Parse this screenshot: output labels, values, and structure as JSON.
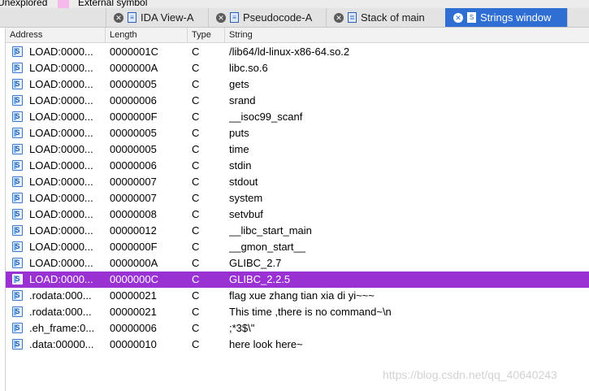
{
  "legend": {
    "unexplored_label": "Unexplored",
    "external_symbol_label": "External symbol",
    "external_symbol_color": "#f7b8ec"
  },
  "tabs": [
    {
      "label": "IDA View-A",
      "icon": "disassembly-icon",
      "active": false
    },
    {
      "label": "Pseudocode-A",
      "icon": "pseudocode-icon",
      "active": false
    },
    {
      "label": "Stack of main",
      "icon": "stack-icon",
      "active": false
    },
    {
      "label": "Strings window",
      "icon": "strings-icon",
      "active": true
    }
  ],
  "table": {
    "columns": [
      "Address",
      "Length",
      "Type",
      "String"
    ],
    "selected_row_color": "#9a31d2",
    "rows": [
      {
        "address": "LOAD:0000...",
        "length": "0000001C",
        "type": "C",
        "string": "/lib64/ld-linux-x86-64.so.2",
        "selected": false
      },
      {
        "address": "LOAD:0000...",
        "length": "0000000A",
        "type": "C",
        "string": "libc.so.6",
        "selected": false
      },
      {
        "address": "LOAD:0000...",
        "length": "00000005",
        "type": "C",
        "string": "gets",
        "selected": false
      },
      {
        "address": "LOAD:0000...",
        "length": "00000006",
        "type": "C",
        "string": "srand",
        "selected": false
      },
      {
        "address": "LOAD:0000...",
        "length": "0000000F",
        "type": "C",
        "string": "__isoc99_scanf",
        "selected": false
      },
      {
        "address": "LOAD:0000...",
        "length": "00000005",
        "type": "C",
        "string": "puts",
        "selected": false
      },
      {
        "address": "LOAD:0000...",
        "length": "00000005",
        "type": "C",
        "string": "time",
        "selected": false
      },
      {
        "address": "LOAD:0000...",
        "length": "00000006",
        "type": "C",
        "string": "stdin",
        "selected": false
      },
      {
        "address": "LOAD:0000...",
        "length": "00000007",
        "type": "C",
        "string": "stdout",
        "selected": false
      },
      {
        "address": "LOAD:0000...",
        "length": "00000007",
        "type": "C",
        "string": "system",
        "selected": false
      },
      {
        "address": "LOAD:0000...",
        "length": "00000008",
        "type": "C",
        "string": "setvbuf",
        "selected": false
      },
      {
        "address": "LOAD:0000...",
        "length": "00000012",
        "type": "C",
        "string": "__libc_start_main",
        "selected": false
      },
      {
        "address": "LOAD:0000...",
        "length": "0000000F",
        "type": "C",
        "string": "__gmon_start__",
        "selected": false
      },
      {
        "address": "LOAD:0000...",
        "length": "0000000A",
        "type": "C",
        "string": "GLIBC_2.7",
        "selected": false
      },
      {
        "address": "LOAD:0000...",
        "length": "0000000C",
        "type": "C",
        "string": "GLIBC_2.2.5",
        "selected": true
      },
      {
        "address": ".rodata:000...",
        "length": "00000021",
        "type": "C",
        "string": "flag xue zhang tian xia di yi~~~",
        "selected": false
      },
      {
        "address": ".rodata:000...",
        "length": "00000021",
        "type": "C",
        "string": "This time ,there is no command~\\n",
        "selected": false
      },
      {
        "address": ".eh_frame:0...",
        "length": "00000006",
        "type": "C",
        "string": ";*3$\\\"",
        "selected": false
      },
      {
        "address": ".data:00000...",
        "length": "00000010",
        "type": "C",
        "string": "here look here~",
        "selected": false
      }
    ]
  },
  "watermark": "https://blog.csdn.net/qq_40640243"
}
